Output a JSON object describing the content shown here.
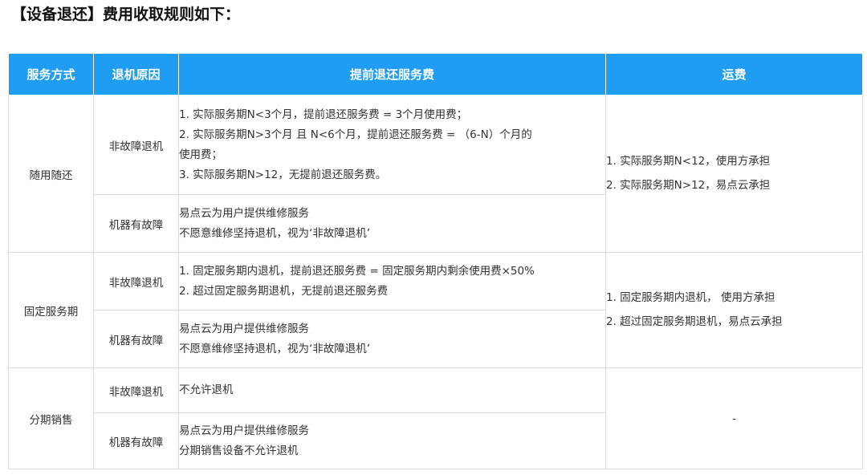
{
  "title": "【设备退还】费用收取规则如下：",
  "headers": [
    "服务方式",
    "退机原因",
    "提前退还服务费",
    "运费"
  ],
  "rows": [
    {
      "service": "随用随还",
      "fault_free": {
        "reason": "非故障退机",
        "lines": [
          "1. 实际服务期N<3个月，提前退还服务费 = 3个月使用费；",
          "2. 实际服务期N>3个月 且 N<6个月，提前退还服务费 = （6-N）个月的",
          "使用费；",
          "3. 实际服务期N>12，无提前退还服务费。"
        ]
      },
      "faulty": {
        "reason": "机器有故障",
        "lines": [
          "易点云为用户提供维修服务",
          "不愿意维修坚持退机，视为‘非故障退机’"
        ]
      },
      "freight": [
        "1. 实际服务期N<12，使用方承担",
        "2. 实际服务期N>12，易点云承担"
      ]
    },
    {
      "service": "固定服务期",
      "fault_free": {
        "reason": "非故障退机",
        "lines": [
          "1. 固定服务期内退机，提前退还服务费 = 固定服务期内剩余使用费×50%",
          "2. 超过固定服务期退机，无提前退还服务费"
        ]
      },
      "faulty": {
        "reason": "机器有故障",
        "lines": [
          "易点云为用户提供维修服务",
          "不愿意维修坚持退机，视为‘非故障退机’"
        ]
      },
      "freight": [
        "1. 固定服务期内退机， 使用方承担",
        "2. 超过固定服务期退机，易点云承担"
      ]
    },
    {
      "service": "分期销售",
      "fault_free": {
        "reason": "非故障退机",
        "lines": [
          "不允许退机"
        ]
      },
      "faulty": {
        "reason": "机器有故障",
        "lines": [
          "易点云为用户提供维修服务",
          "分期销售设备不允许退机"
        ]
      },
      "freight": [
        "-"
      ]
    }
  ]
}
